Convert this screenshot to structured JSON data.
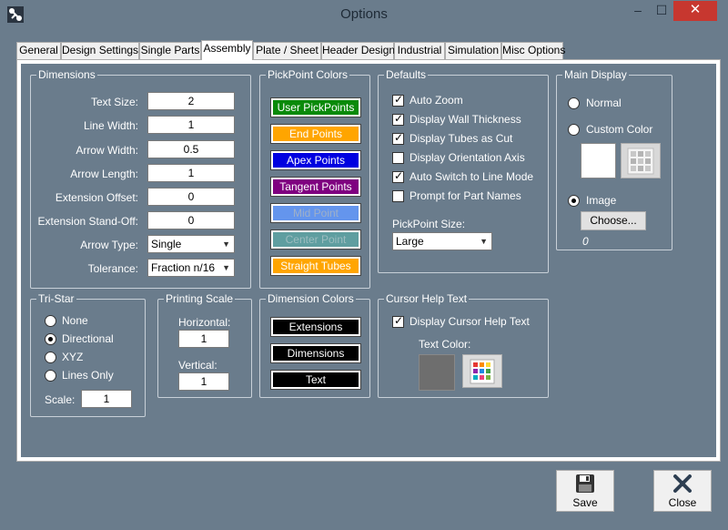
{
  "window": {
    "title": "Options",
    "minimize": "–",
    "maximize": "☐",
    "close": "✕"
  },
  "tabs": [
    {
      "label": "General"
    },
    {
      "label": "Design Settings"
    },
    {
      "label": "Single Parts"
    },
    {
      "label": "Assembly",
      "active": true
    },
    {
      "label": "Plate / Sheet"
    },
    {
      "label": "Header Design"
    },
    {
      "label": "Industrial"
    },
    {
      "label": "Simulation"
    },
    {
      "label": "Misc Options"
    }
  ],
  "dimensions": {
    "title": "Dimensions",
    "text_size_label": "Text Size:",
    "text_size": "2",
    "line_width_label": "Line Width:",
    "line_width": "1",
    "arrow_width_label": "Arrow Width:",
    "arrow_width": "0.5",
    "arrow_length_label": "Arrow Length:",
    "arrow_length": "1",
    "ext_offset_label": "Extension Offset:",
    "ext_offset": "0",
    "ext_standoff_label": "Extension Stand-Off:",
    "ext_standoff": "0",
    "arrow_type_label": "Arrow Type:",
    "arrow_type": "Single",
    "tolerance_label": "Tolerance:",
    "tolerance": "Fraction n/16"
  },
  "pickpoint_colors": {
    "title": "PickPoint Colors",
    "user": {
      "label": "User PickPoints",
      "bg": "#0a8a0a",
      "fg": "#ffffff"
    },
    "end": {
      "label": "End Points",
      "bg": "#ffa500",
      "fg": "#ffffff"
    },
    "apex": {
      "label": "Apex Points",
      "bg": "#0000e0",
      "fg": "#ffffff"
    },
    "tangent": {
      "label": "Tangent Points",
      "bg": "#7f0080",
      "fg": "#ffffff"
    },
    "mid": {
      "label": "Mid Point",
      "bg": "#6495ed",
      "fg": "#9fb0c8"
    },
    "center": {
      "label": "Center Point",
      "bg": "#5f9ea0",
      "fg": "#9cbcbf"
    },
    "straight": {
      "label": "Straight Tubes",
      "bg": "#ffa500",
      "fg": "#ffffff"
    }
  },
  "defaults": {
    "title": "Defaults",
    "auto_zoom": "Auto Zoom",
    "wall_thickness": "Display Wall Thickness",
    "tubes_as_cut": "Display Tubes as Cut",
    "orientation_axis": "Display Orientation Axis",
    "auto_switch": "Auto Switch to Line Mode",
    "prompt_names": "Prompt for Part Names",
    "pickpoint_size_label": "PickPoint Size:",
    "pickpoint_size": "Large"
  },
  "main_display": {
    "title": "Main Display",
    "normal": "Normal",
    "custom_color": "Custom Color",
    "image": "Image",
    "choose": "Choose...",
    "image_value": "0"
  },
  "tristar": {
    "title": "Tri-Star",
    "none": "None",
    "directional": "Directional",
    "xyz": "XYZ",
    "lines_only": "Lines Only",
    "scale_label": "Scale:",
    "scale": "1"
  },
  "printing_scale": {
    "title": "Printing Scale",
    "horizontal_label": "Horizontal:",
    "horizontal": "1",
    "vertical_label": "Vertical:",
    "vertical": "1"
  },
  "dimension_colors": {
    "title": "Dimension Colors",
    "extensions": "Extensions",
    "dimensions": "Dimensions",
    "text": "Text"
  },
  "cursor_help": {
    "title": "Cursor Help Text",
    "display": "Display Cursor Help Text",
    "text_color_label": "Text Color:",
    "swatch_color": "#6e6e6e"
  },
  "footer": {
    "save": "Save",
    "close": "Close"
  }
}
